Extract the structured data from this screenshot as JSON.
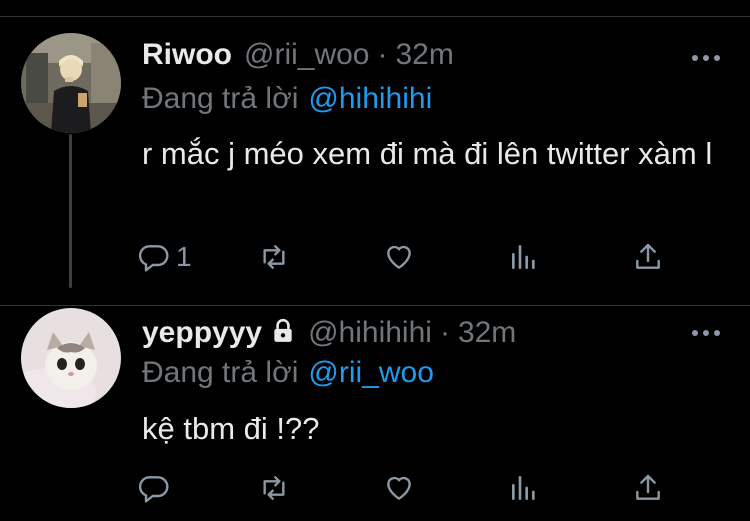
{
  "tweets": [
    {
      "name": "Riwoo",
      "handle": "@rii_woo",
      "separator": "·",
      "time": "32m",
      "replying_prefix": "Đang trả lời",
      "replying_to": "@hihihihi",
      "text": "r mắc j méo xem đi mà đi lên twitter xàm l",
      "reply_count": "1",
      "protected": false
    },
    {
      "name": "yeppyyy",
      "handle": "@hihihihi",
      "separator": "·",
      "time": "32m",
      "replying_prefix": "Đang trả lời",
      "replying_to": "@rii_woo",
      "text": "kệ tbm đi !??",
      "reply_count": "",
      "protected": true
    }
  ],
  "colors": {
    "background": "#000000",
    "text": "#e7e9ea",
    "muted": "#71767b",
    "link": "#1d9bf0",
    "divider": "#2f3336"
  },
  "icons": [
    "reply-icon",
    "retweet-icon",
    "like-icon",
    "analytics-icon",
    "share-icon",
    "more-icon",
    "lock-icon"
  ]
}
